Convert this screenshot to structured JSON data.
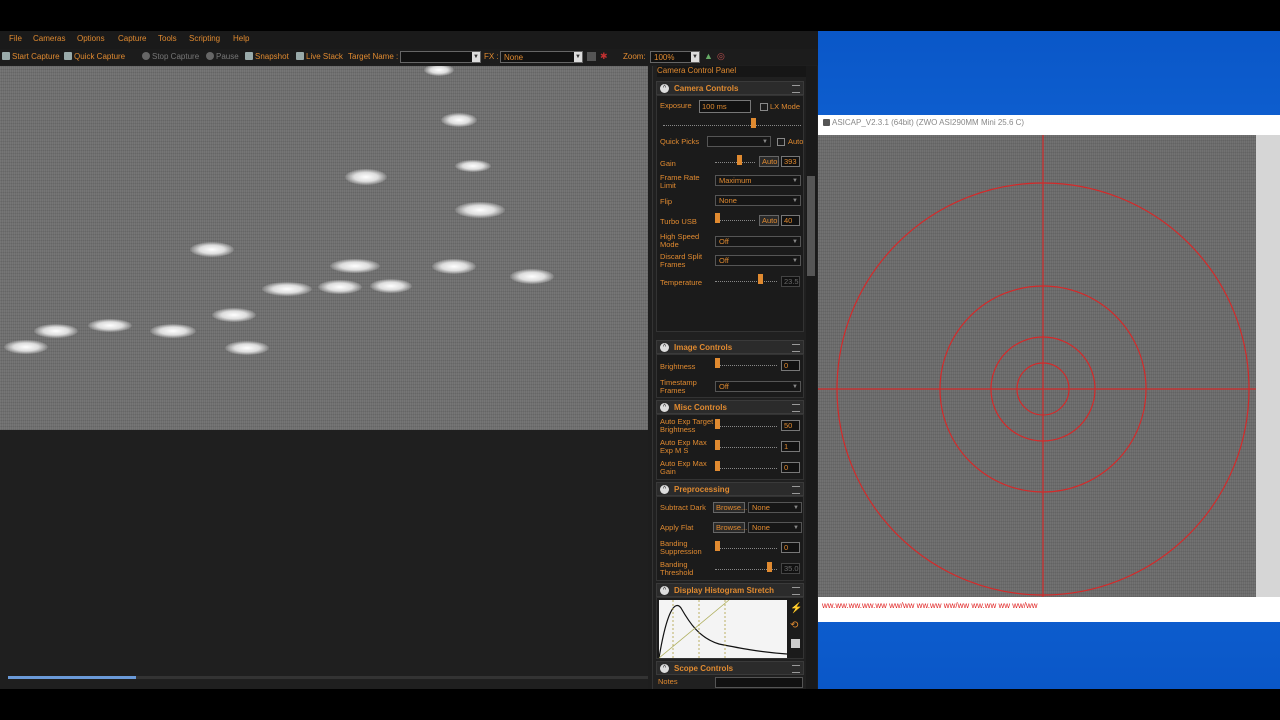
{
  "menu": [
    "File",
    "Cameras",
    "Options",
    "Capture",
    "Tools",
    "Scripting",
    "Help"
  ],
  "toolbar": {
    "start_capture": "Start Capture",
    "quick_capture": "Quick Capture",
    "stop_capture": "Stop Capture",
    "pause": "Pause",
    "snapshot": "Snapshot",
    "live_stack": "Live Stack",
    "target_name_label": "Target Name :",
    "target_name_value": "",
    "fx_label": "FX :",
    "fx_value": "None",
    "zoom_label": "Zoom:",
    "zoom_value": "100%"
  },
  "panel": {
    "title": "Camera Control Panel",
    "camera_controls": {
      "title": "Camera Controls",
      "exposure_label": "Exposure",
      "exposure_value": "100 ms",
      "lx_mode_label": "LX Mode",
      "exposure_slider": 0.66,
      "quick_picks_label": "Quick Picks",
      "quick_picks_value": "",
      "auto_label": "Auto",
      "gain_label": "Gain",
      "gain_auto": "Auto",
      "gain_value": "393",
      "gain_slider": 0.62,
      "frame_rate_label": "Frame Rate Limit",
      "frame_rate_value": "Maximum",
      "flip_label": "Flip",
      "flip_value": "None",
      "turbo_usb_label": "Turbo USB",
      "turbo_auto": "Auto",
      "turbo_value": "40",
      "turbo_slider": 0.0,
      "high_speed_label": "High Speed Mode",
      "high_speed_value": "Off",
      "discard_split_label": "Discard Split Frames",
      "discard_split_value": "Off",
      "temperature_label": "Temperature",
      "temperature_value": "23.5",
      "temperature_slider": 0.75
    },
    "image_controls": {
      "title": "Image Controls",
      "brightness_label": "Brightness",
      "brightness_value": "0",
      "timestamp_label": "Timestamp Frames",
      "timestamp_value": "Off"
    },
    "misc_controls": {
      "title": "Misc Controls",
      "auto_exp_target_label": "Auto Exp Target Brightness",
      "auto_exp_target_value": "50",
      "auto_exp_max_ms_label": "Auto Exp Max Exp M S",
      "auto_exp_max_ms_value": "1",
      "auto_exp_max_gain_label": "Auto Exp Max Gain",
      "auto_exp_max_gain_value": "0"
    },
    "preprocessing": {
      "title": "Preprocessing",
      "subtract_dark_label": "Subtract Dark",
      "browse": "Browse...",
      "subtract_dark_value": "None",
      "apply_flat_label": "Apply Flat",
      "apply_flat_value": "None",
      "banding_suppression_label": "Banding Suppression",
      "banding_suppression_value": "0",
      "banding_threshold_label": "Banding Threshold",
      "banding_threshold_value": "35.0"
    },
    "histogram": {
      "title": "Display Histogram Stretch"
    },
    "scope_controls": {
      "title": "Scope Controls",
      "notes_label": "Notes"
    }
  },
  "progress": 0.2,
  "asicap": {
    "title": "ASICAP_V2.3.1 (64bit) (ZWO ASI290MM Mini 25.6 C)",
    "status": "ww.ww.ww.ww.ww ww/ww ww.ww ww/ww ww.ww ww ww/ww"
  },
  "colors": {
    "accent": "#e08a30",
    "reticle": "#d42a2a",
    "desktop": "#0a57c8"
  }
}
